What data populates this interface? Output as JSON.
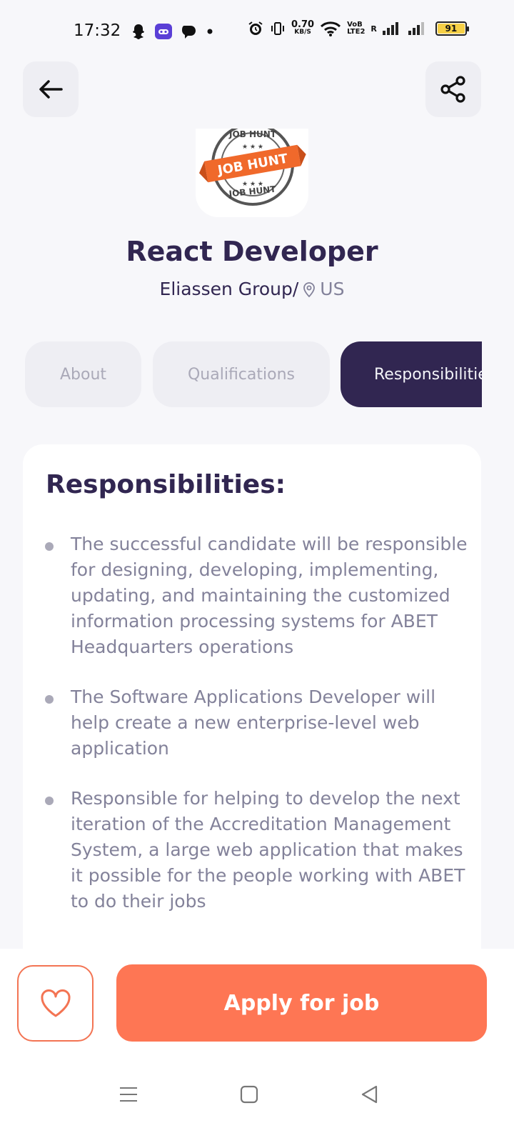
{
  "status_bar": {
    "time": "17:32",
    "net_speed_value": "0.70",
    "net_speed_unit": "KB/S",
    "volte_top": "VoB",
    "volte_bottom": "LTE2",
    "roaming": "R",
    "battery": "91"
  },
  "header": {
    "back_icon": "arrow-left-icon",
    "share_icon": "share-icon"
  },
  "job": {
    "logo_top_text": "JOB HUNT",
    "logo_banner_text": "JOB HUNT",
    "logo_bottom_text": "JOB HUNT",
    "title": "React Developer",
    "company": "Eliassen Group/",
    "location": "US"
  },
  "tabs": [
    {
      "label": "About",
      "active": false
    },
    {
      "label": "Qualifications",
      "active": false
    },
    {
      "label": "Responsibilities",
      "active": true
    }
  ],
  "content": {
    "title": "Responsibilities:",
    "items": [
      "The successful candidate will be responsible for designing, developing, implementing, updating, and maintaining the customized information processing systems for ABET Headquarters operations",
      "The Software Applications Developer will help create a new enterprise-level web application",
      "Responsible for helping to develop the next iteration of the Accreditation Management System, a large web application that makes it possible for the people working with ABET to do their jobs"
    ]
  },
  "footer": {
    "like_icon": "heart-icon",
    "apply_label": "Apply for job"
  },
  "colors": {
    "primary": "#312651",
    "accent": "#FE7654",
    "gray": "#83829A",
    "background": "#F3F4F8"
  }
}
